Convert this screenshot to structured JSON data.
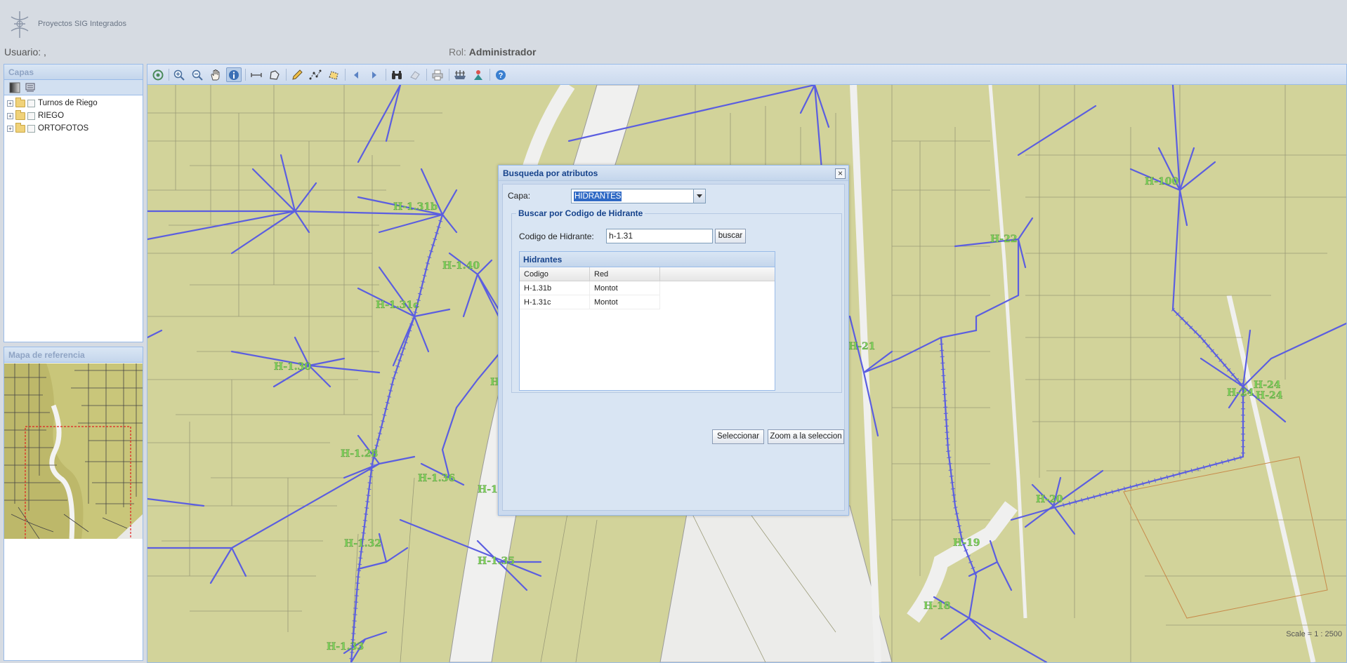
{
  "header": {
    "app_name": "Proyectos SIG Integrados",
    "user_label": "Usuario: ,",
    "role_label": "Rol:",
    "role_value": "Administrador"
  },
  "layers_panel": {
    "title": "Capas",
    "items": [
      {
        "label": "Turnos de Riego"
      },
      {
        "label": "RIEGO"
      },
      {
        "label": "ORTOFOTOS"
      }
    ]
  },
  "ref_panel": {
    "title": "Mapa de referencia"
  },
  "map": {
    "scale_text": "Scale = 1 : 2500",
    "toolbar_icons": [
      "zoom-extent-icon",
      "zoom-in-icon",
      "zoom-out-icon",
      "pan-hand-icon",
      "info-icon",
      "measure-distance-icon",
      "measure-area-icon",
      "draw-pencil-icon",
      "draw-line-icon",
      "draw-polygon-icon",
      "previous-extent-icon",
      "next-extent-icon",
      "find-binoculars-icon",
      "clear-selection-icon",
      "print-icon",
      "layers-tool-icon",
      "user-location-icon",
      "help-icon"
    ],
    "hydrant_labels": [
      "H-1.31b",
      "H-1.40",
      "H-1.31c",
      "H-1.30",
      "H-1.28",
      "H-1.36",
      "H-1.32",
      "H-1.35",
      "H-1.33",
      "H-22",
      "H-21",
      "H-100",
      "H-24",
      "H-24",
      "H-24",
      "H-20",
      "H-19",
      "H-18",
      "H-1.",
      "H"
    ]
  },
  "colors": {
    "parcel_fill": "#d2d39a",
    "pipe": "#5b5ee0",
    "label": "#7fd15a",
    "panel_header": "#dae6f4",
    "dialog_bg": "#d9e5f3"
  },
  "dialog": {
    "title": "Busqueda por atributos",
    "close_symbol": "×",
    "capa_label": "Capa:",
    "capa_value": "HIDRANTES",
    "fieldset_legend": "Buscar por Codigo de Hidrante",
    "codigo_label": "Codigo de Hidrante:",
    "codigo_value": "h-1.31",
    "buscar_label": "buscar",
    "grid": {
      "title": "Hidrantes",
      "columns": [
        "Codigo",
        "Red"
      ],
      "rows": [
        [
          "H-1.31b",
          "Montot"
        ],
        [
          "H-1.31c",
          "Montot"
        ]
      ]
    },
    "select_label": "Seleccionar",
    "zoom_label": "Zoom a la seleccion"
  }
}
